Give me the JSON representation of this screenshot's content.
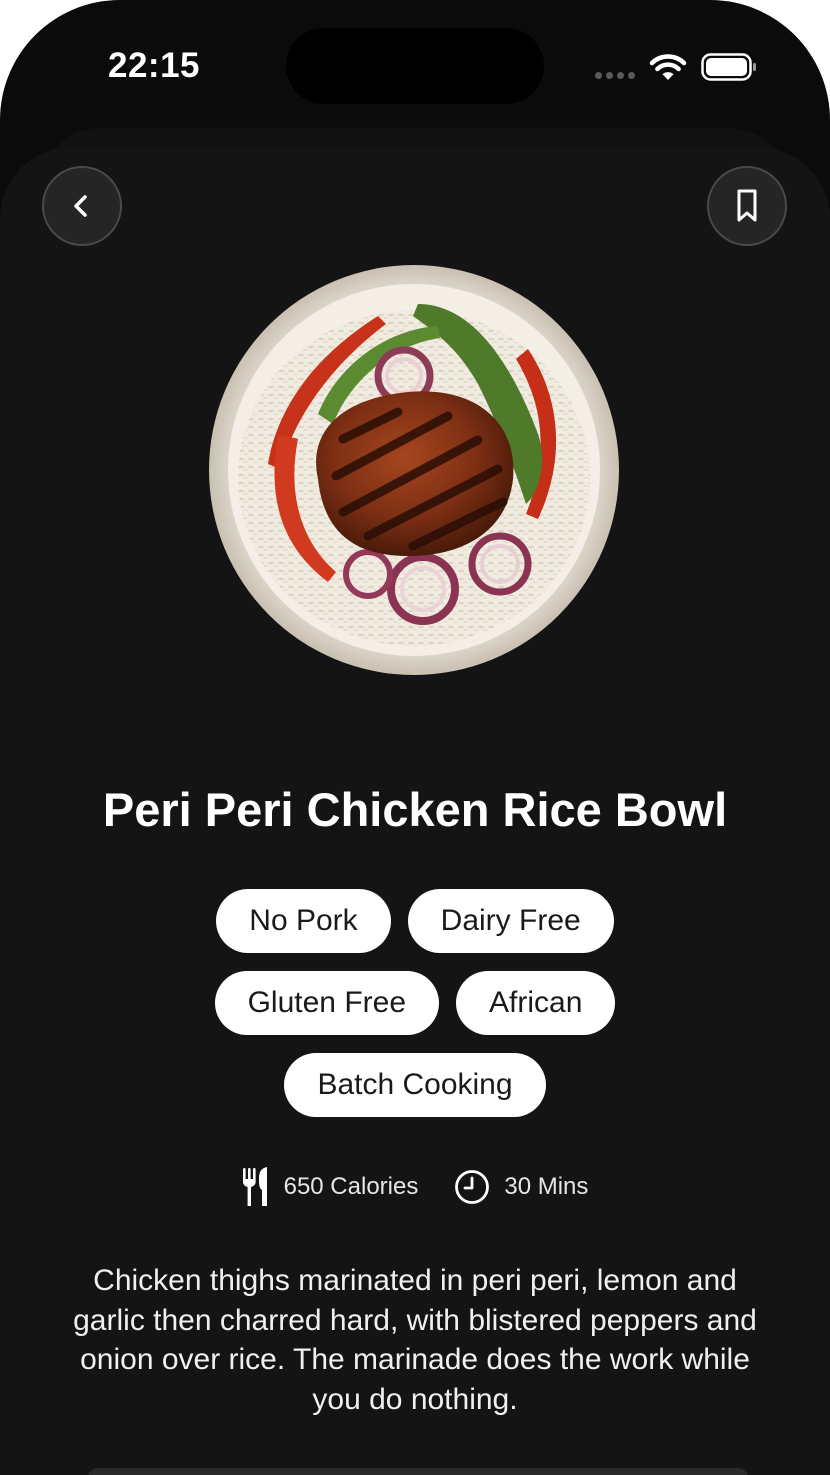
{
  "status_bar": {
    "time": "22:15"
  },
  "header": {
    "back_icon": "chevron-left-icon",
    "bookmark_icon": "bookmark-icon"
  },
  "recipe": {
    "image_description": "peri-peri-chicken-rice-bowl",
    "title": "Peri Peri Chicken Rice Bowl",
    "tags": [
      "No Pork",
      "Dairy Free",
      "Gluten Free",
      "African",
      "Batch Cooking"
    ],
    "calories": "650 Calories",
    "time": "30 Mins",
    "description": "Chicken thighs marinated in peri peri, lemon and garlic then charred hard, with blistered peppers and onion over rice. The marinade does the work while you do nothing."
  },
  "colors": {
    "background": "#141414",
    "tag_background": "#ffffff",
    "text": "#ffffff"
  }
}
